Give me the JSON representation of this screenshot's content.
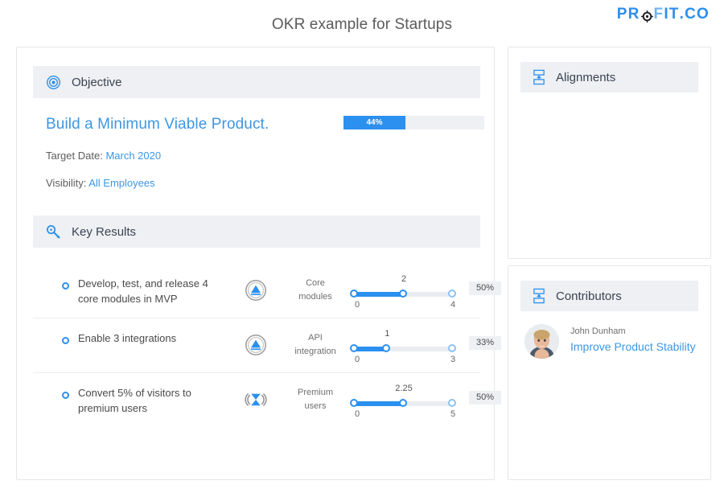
{
  "header": {
    "title": "OKR example for Startups",
    "logo": {
      "before": "PR",
      "target_icon": "target-icon",
      "middle_f": "F",
      "after": "IT",
      "dot": ".",
      "suffix": "CO"
    }
  },
  "objective": {
    "section_label": "Objective",
    "section_icon": "target-icon",
    "title": "Build a Minimum Viable Product.",
    "progress": {
      "percent_label": "44%",
      "percent_value": 44
    },
    "target_date_label": "Target Date:",
    "target_date_value": "March 2020",
    "visibility_label": "Visibility:",
    "visibility_value": "All Employees"
  },
  "key_results": {
    "section_label": "Key Results",
    "section_icon": "key-icon",
    "rows": [
      {
        "text": "Develop, test, and release 4 core modules in MVP",
        "type_icon": "increase-triangle-icon",
        "metric_line1": "Core",
        "metric_line2": "modules",
        "current": "2",
        "min": "0",
        "max": "4",
        "fill_percent": 50,
        "percent_label": "50%"
      },
      {
        "text": "Enable 3 integrations",
        "type_icon": "increase-triangle-icon",
        "metric_line1": "API",
        "metric_line2": "integration",
        "current": "1",
        "min": "0",
        "max": "3",
        "fill_percent": 33,
        "percent_label": "33%"
      },
      {
        "text": "Convert 5% of visitors to premium users",
        "type_icon": "percentage-hourglass-icon",
        "metric_line1": "Premium",
        "metric_line2": "users",
        "current": "2.25",
        "min": "0",
        "max": "5",
        "fill_percent": 50,
        "percent_label": "50%"
      }
    ]
  },
  "alignments": {
    "section_label": "Alignments",
    "section_icon": "alignment-icon"
  },
  "contributors": {
    "section_label": "Contributors",
    "section_icon": "alignment-icon",
    "items": [
      {
        "name": "John Dunham",
        "objective": "Improve Product Stability",
        "avatar": "user-photo"
      }
    ]
  },
  "colors": {
    "accent_blue": "#2b90ef",
    "link_blue": "#3d97e4",
    "header_bar": "#eef0f3",
    "card_border": "#e4e6ea",
    "text_dark": "#3a4352"
  }
}
